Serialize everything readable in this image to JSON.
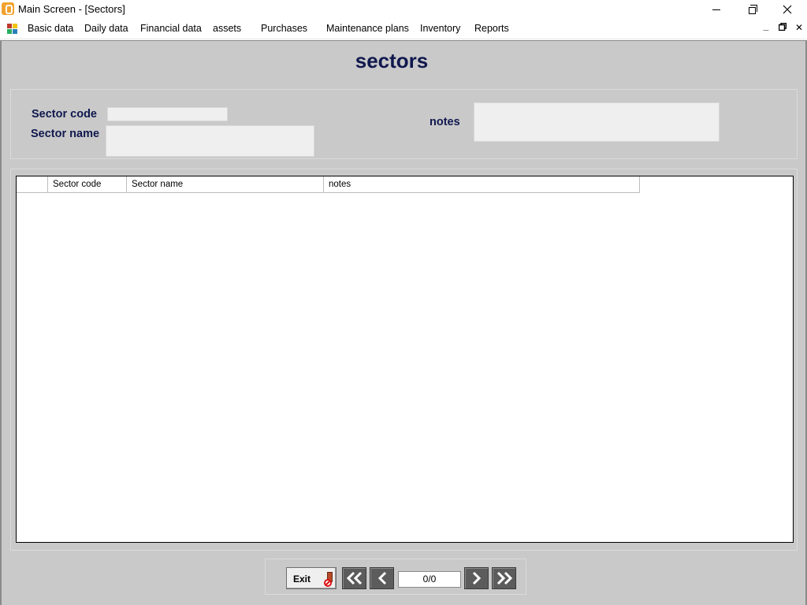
{
  "window": {
    "title": "Main Screen - [Sectors]"
  },
  "menu": {
    "items": [
      {
        "label": "Basic data"
      },
      {
        "label": "Daily data"
      },
      {
        "label": "Financial data"
      },
      {
        "label": "assets"
      },
      {
        "label": "Purchases"
      },
      {
        "label": "Maintenance plans"
      },
      {
        "label": "Inventory"
      },
      {
        "label": "Reports"
      }
    ],
    "mdi_minimize": "_",
    "mdi_close": "✕"
  },
  "form": {
    "title": "sectors",
    "sector_code_label": "Sector code",
    "sector_name_label": "Sector name",
    "notes_label": "notes",
    "sector_code_value": "",
    "sector_name_value": "",
    "notes_value": ""
  },
  "grid": {
    "columns": [
      "",
      "Sector code",
      "Sector name",
      "notes"
    ],
    "rows": []
  },
  "navigator": {
    "exit_label": "Exit",
    "position": "0/0"
  },
  "colors": {
    "title_color": "#10184e",
    "form_background": "#c9c9c9",
    "field_background": "#efefef",
    "nav_button": "#5c5c5c"
  },
  "icons": {
    "app": "app-icon",
    "menu": "mdi-app-icon",
    "exit": "exit-door-icon",
    "first": "double-chevron-left-icon",
    "prev": "chevron-left-icon",
    "next": "chevron-right-icon",
    "last": "double-chevron-right-icon"
  }
}
